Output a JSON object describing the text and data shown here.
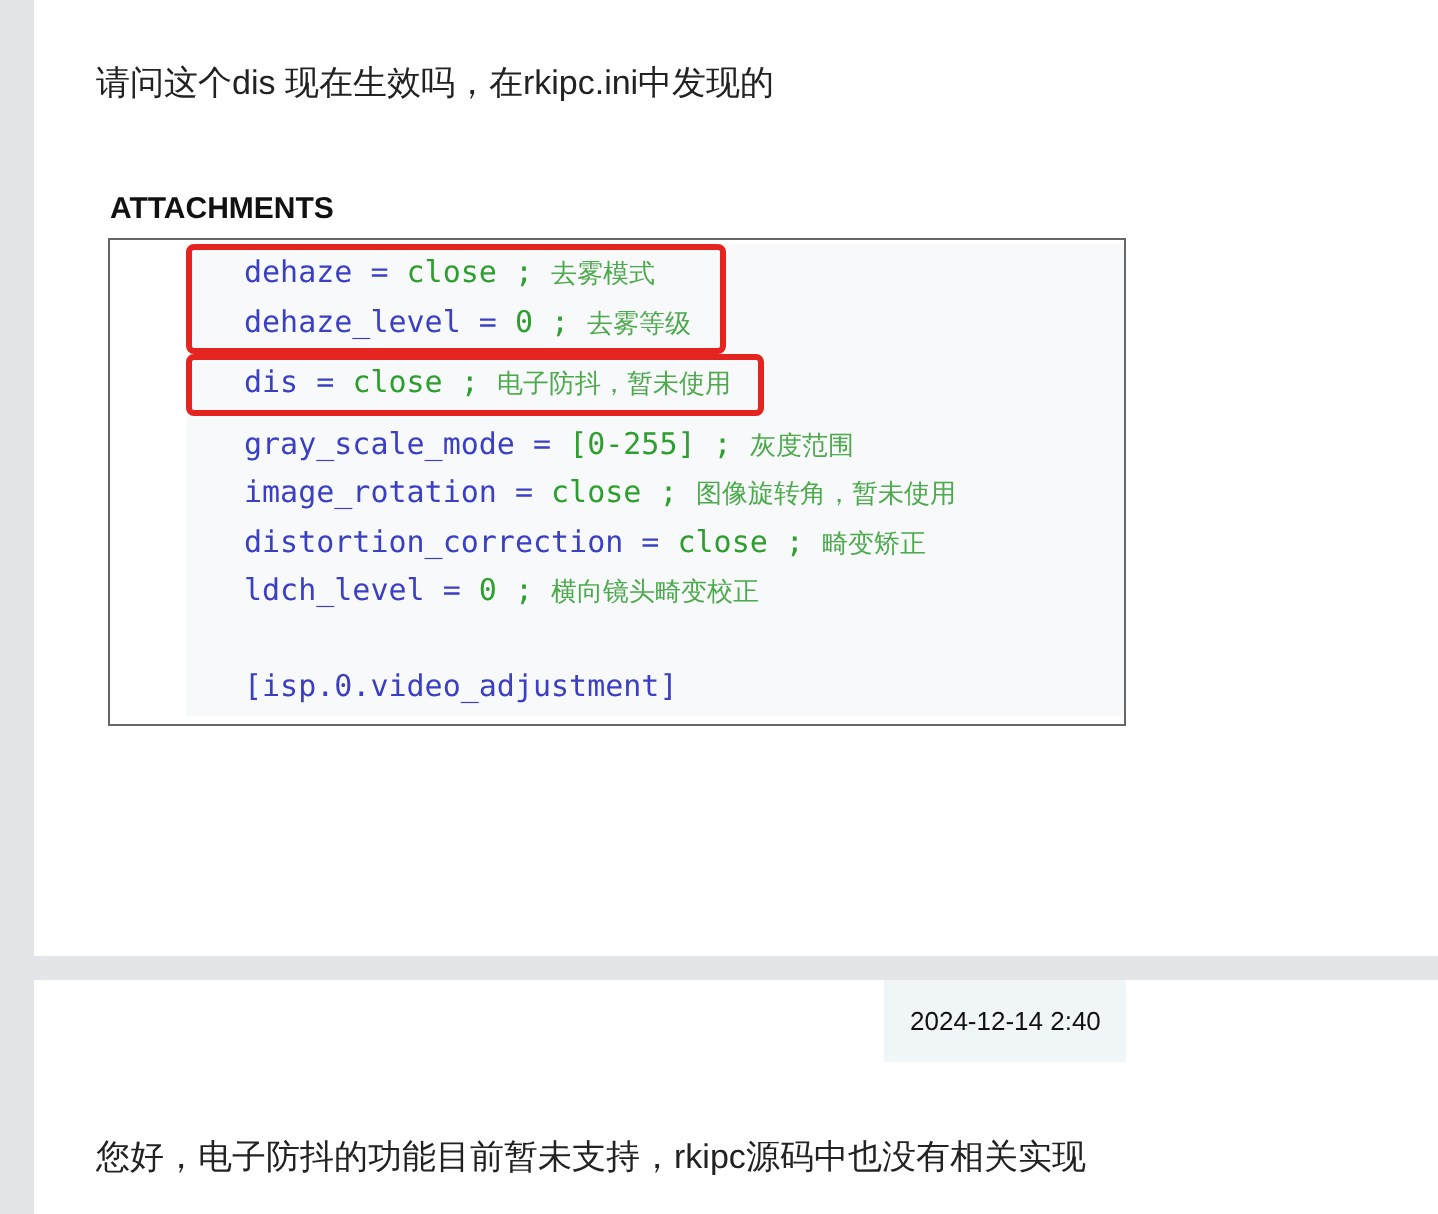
{
  "question": {
    "text": "请问这个dis 现在生效吗，在rkipc.ini中发现的",
    "attachments_heading": "ATTACHMENTS",
    "code_groups": [
      {
        "highlighted": true,
        "lines": [
          {
            "kind": "setting",
            "key": "dehaze =",
            "value": "close ;",
            "comment": "去雾模式"
          },
          {
            "kind": "setting",
            "key": "dehaze_level =",
            "value": "0 ;",
            "comment": "去雾等级"
          }
        ]
      },
      {
        "highlighted": true,
        "lines": [
          {
            "kind": "setting",
            "key": "dis =",
            "value": "close ;",
            "comment": "电子防抖，暂未使用"
          }
        ]
      },
      {
        "highlighted": false,
        "lines": [
          {
            "kind": "setting",
            "key": "gray_scale_mode =",
            "value": "[0-255] ;",
            "comment": "灰度范围"
          },
          {
            "kind": "setting",
            "key": "image_rotation =",
            "value": "close ;",
            "comment": "图像旋转角，暂未使用"
          },
          {
            "kind": "setting",
            "key": "distortion_correction =",
            "value": "close ;",
            "comment": "畸变矫正"
          },
          {
            "kind": "setting",
            "key": "ldch_level =",
            "value": "0 ;",
            "comment": "横向镜头畸变校正"
          },
          {
            "kind": "section",
            "key": "[isp.0.video_adjustment]"
          }
        ]
      }
    ]
  },
  "answer": {
    "timestamp": "2024-12-14 2:40",
    "text": "您好，电子防抖的功能目前暂未支持，rkipc源码中也没有相关实现"
  }
}
